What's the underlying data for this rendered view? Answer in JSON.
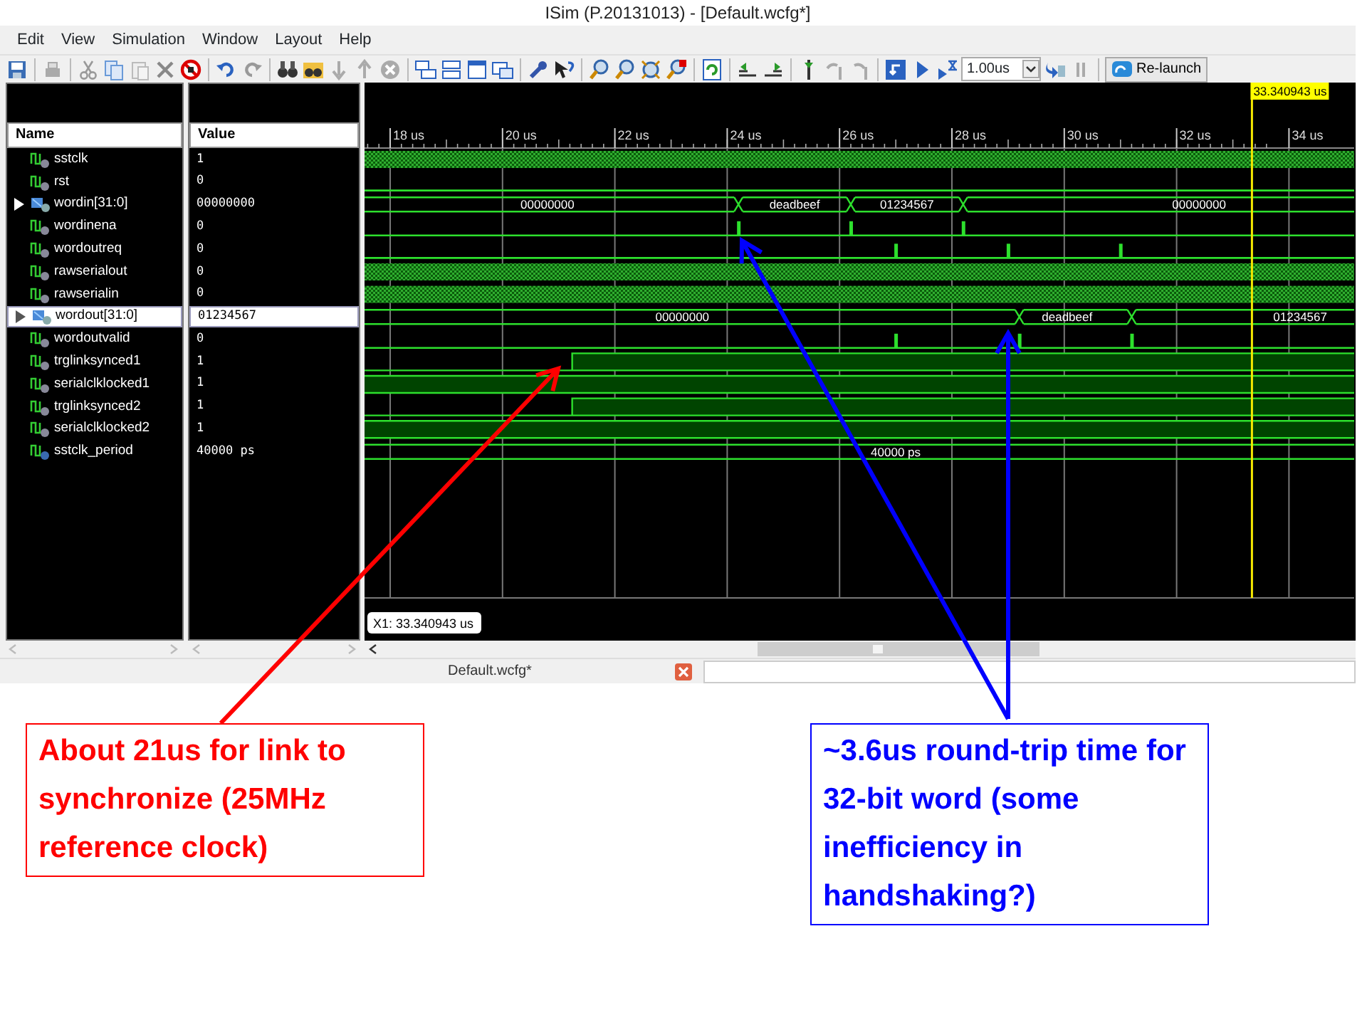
{
  "window": {
    "title": "ISim (P.20131013) - [Default.wcfg*]"
  },
  "menu": [
    {
      "label": "Edit"
    },
    {
      "label": "View"
    },
    {
      "label": "Simulation"
    },
    {
      "label": "Window"
    },
    {
      "label": "Layout"
    },
    {
      "label": "Help"
    }
  ],
  "toolbar": {
    "run_time": "1.00us",
    "relaunch": "Re-launch"
  },
  "columns": [
    "Name",
    "Value"
  ],
  "cursor": {
    "label": "33.340943 us",
    "readout": "X1: 33.340943 us"
  },
  "time_ticks": [
    "18 us",
    "20 us",
    "22 us",
    "24 us",
    "26 us",
    "28 us",
    "30 us",
    "32 us",
    "34 us"
  ],
  "signals": [
    {
      "name": "sstclk",
      "value": "1",
      "kind": "clock",
      "selected": false
    },
    {
      "name": "rst",
      "value": "0",
      "kind": "low",
      "selected": false
    },
    {
      "name": "wordin[31:0]",
      "value": "00000000",
      "kind": "bus",
      "expanded": false,
      "segments": [
        "00000000",
        "deadbeef",
        "01234567",
        "00000000"
      ],
      "selected": false
    },
    {
      "name": "wordinena",
      "value": "0",
      "kind": "pulse",
      "selected": false
    },
    {
      "name": "wordoutreq",
      "value": "0",
      "kind": "pulse",
      "selected": false
    },
    {
      "name": "rawserialout",
      "value": "0",
      "kind": "clock",
      "selected": false
    },
    {
      "name": "rawserialin",
      "value": "0",
      "kind": "clock",
      "selected": false
    },
    {
      "name": "wordout[31:0]",
      "value": "01234567",
      "kind": "bus",
      "expanded": false,
      "segments": [
        "00000000",
        "deadbeef",
        "01234567"
      ],
      "selected": true
    },
    {
      "name": "wordoutvalid",
      "value": "0",
      "kind": "pulse",
      "selected": false
    },
    {
      "name": "trglinksynced1",
      "value": "1",
      "kind": "step",
      "selected": false
    },
    {
      "name": "serialclklocked1",
      "value": "1",
      "kind": "high",
      "selected": false
    },
    {
      "name": "trglinksynced2",
      "value": "1",
      "kind": "step",
      "selected": false
    },
    {
      "name": "serialclklocked2",
      "value": "1",
      "kind": "high",
      "selected": false
    },
    {
      "name": "sstclk_period",
      "value": "40000 ps",
      "kind": "bus",
      "segments": [
        "40000 ps"
      ],
      "selected": false
    }
  ],
  "document_tab": {
    "label": "Default.wcfg*"
  },
  "annotations": [
    {
      "text": "About 21us for link to synchronize (25MHz reference clock)",
      "color": "#ff0000"
    },
    {
      "text": "~3.6us round-trip time for 32-bit word (some inefficiency in handshaking?)",
      "color": "#0000ff"
    }
  ]
}
